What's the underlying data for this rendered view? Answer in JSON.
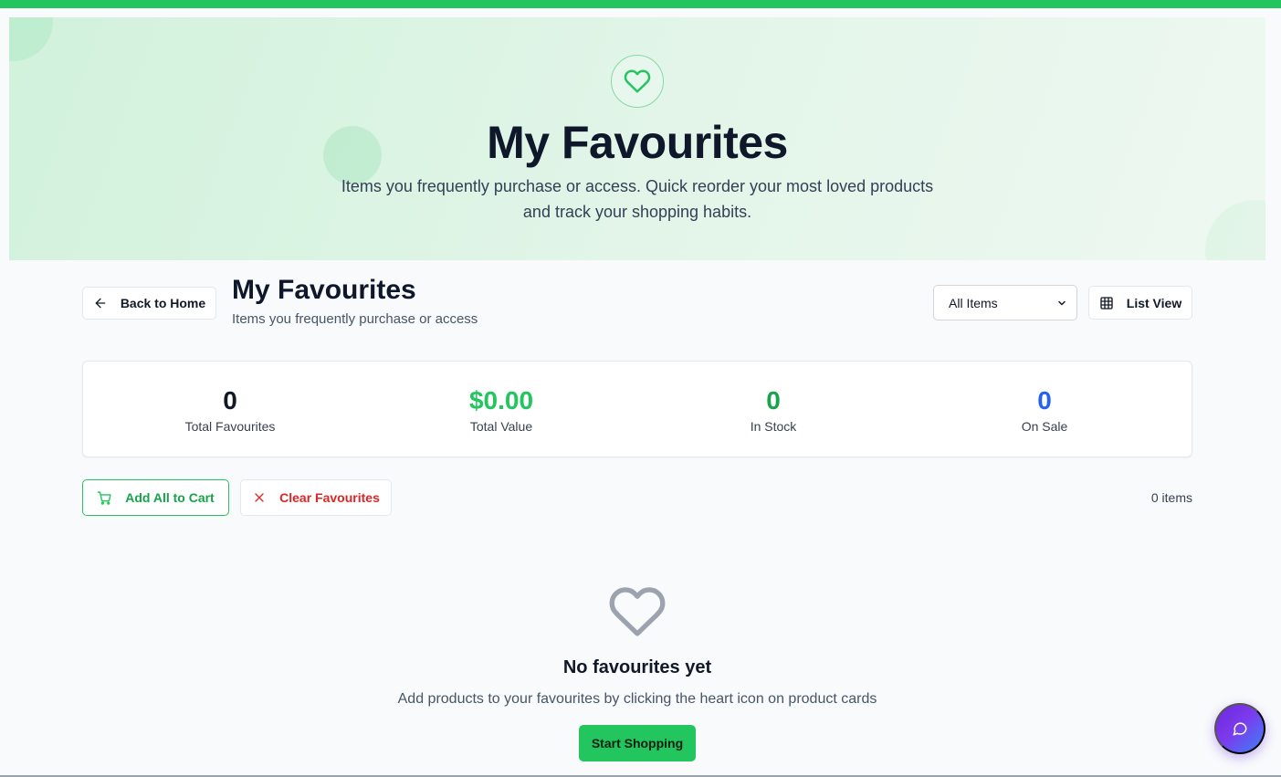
{
  "hero": {
    "title": "My Favourites",
    "subtitle": "Items you frequently purchase or access. Quick reorder your most loved products and track your shopping habits.",
    "icon": "heart-icon"
  },
  "header": {
    "back_label": "Back to Home",
    "title": "My Favourites",
    "subtitle": "Items you frequently purchase or access",
    "filter": {
      "selected": "All Items",
      "options": [
        "All Items"
      ]
    },
    "view_label": "List View"
  },
  "stats": [
    {
      "value": "0",
      "label": "Total Favourites",
      "color": "#111827"
    },
    {
      "value": "$0.00",
      "label": "Total Value",
      "color": "#22c55e"
    },
    {
      "value": "0",
      "label": "In Stock",
      "color": "#16a34a"
    },
    {
      "value": "0",
      "label": "On Sale",
      "color": "#2563eb"
    }
  ],
  "actions": {
    "add_all_label": "Add All to Cart",
    "clear_label": "Clear Favourites",
    "count": "0 items"
  },
  "empty": {
    "title": "No favourites yet",
    "subtitle": "Add products to your favourites by clicking the heart icon on product cards",
    "button": "Start Shopping"
  },
  "colors": {
    "accent": "#22c55e",
    "danger": "#dc2626",
    "info": "#2563eb",
    "chat_gradient_start": "#6d28d9",
    "chat_gradient_end": "#3b82f6"
  }
}
